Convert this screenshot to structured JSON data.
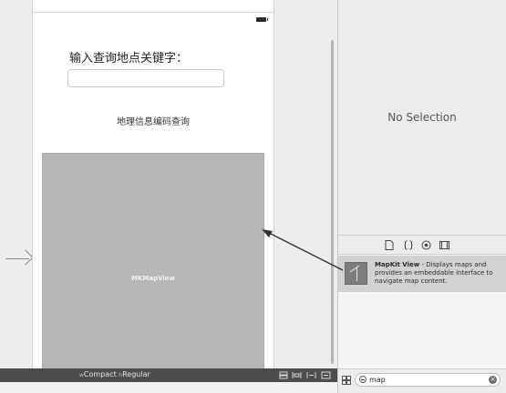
{
  "scene": {
    "keyword_label": "输入查询地点关键字：",
    "keyword_input_value": "",
    "geocode_button_label": "地理信息编码查询",
    "mapview_label": "MKMapView"
  },
  "bottom_bar": {
    "width_prefix": "w",
    "width_class": "Compact",
    "height_prefix": "h",
    "height_class": "Regular"
  },
  "inspector": {
    "no_selection": "No Selection"
  },
  "library": {
    "item_title": "MapKit View",
    "item_description": " - Displays maps and provides an embeddable interface to navigate map content."
  },
  "filter": {
    "value": "map"
  },
  "icons": {
    "entry": "entry-arrow-icon",
    "battery": "battery-icon",
    "file": "file-template-icon",
    "code": "code-snippet-icon",
    "object": "object-library-icon",
    "media": "media-library-icon",
    "grid": "grid-view-icon",
    "search": "search-icon",
    "clear": "clear-icon",
    "mapkit": "mapkit-view-icon"
  }
}
